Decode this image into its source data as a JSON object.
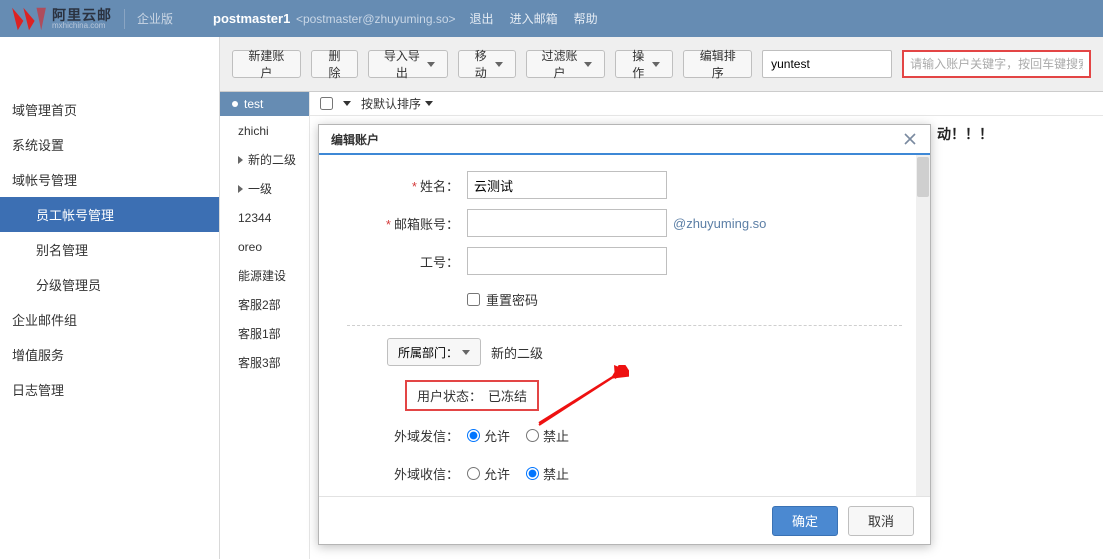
{
  "topbar": {
    "logo_main": "阿里云邮",
    "edition": "企业版",
    "user_name": "postmaster1",
    "user_addr": "<postmaster@zhuyuming.so>",
    "links": {
      "logout": "退出",
      "enter_mail": "进入邮箱",
      "help": "帮助"
    }
  },
  "leftnav": {
    "items": [
      "域管理首页",
      "系统设置",
      "域帐号管理"
    ],
    "subs": [
      "员工帐号管理",
      "别名管理",
      "分级管理员"
    ],
    "items_tail": [
      "企业邮件组",
      "增值服务",
      "日志管理"
    ]
  },
  "toolbar": {
    "new_account": "新建账户",
    "delete": "删除",
    "import_export": "导入导出",
    "move": "移动",
    "filter": "过滤账户",
    "operate": "操作",
    "edit_sort": "编辑排序",
    "search_small_value": "yuntest",
    "search_main_placeholder": "请输入账户关键字，按回车键搜索"
  },
  "tree": {
    "header": "test",
    "items": [
      "zhichi",
      "新的二级",
      "一级",
      "12344",
      "oreo",
      "能源建设",
      "客服2部",
      "客服1部",
      "客服3部"
    ]
  },
  "list": {
    "sort_label": "按默认排序",
    "banner_tail": "动！！！"
  },
  "modal": {
    "title": "编辑账户",
    "labels": {
      "name": "姓名：",
      "email": "邮箱账号：",
      "jobno": "工号：",
      "reset_pwd": "重置密码",
      "dept_btn": "所属部门：",
      "dept_value": "新的二级",
      "status_label": "用户状态：",
      "status_value": "已冻结",
      "out_send": "外域发信：",
      "out_recv": "外域收信：",
      "allow": "允许",
      "forbid": "禁止"
    },
    "values": {
      "name": "云测试",
      "domain_suffix": "@zhuyuming.so"
    },
    "footer": {
      "ok": "确定",
      "cancel": "取消"
    }
  }
}
